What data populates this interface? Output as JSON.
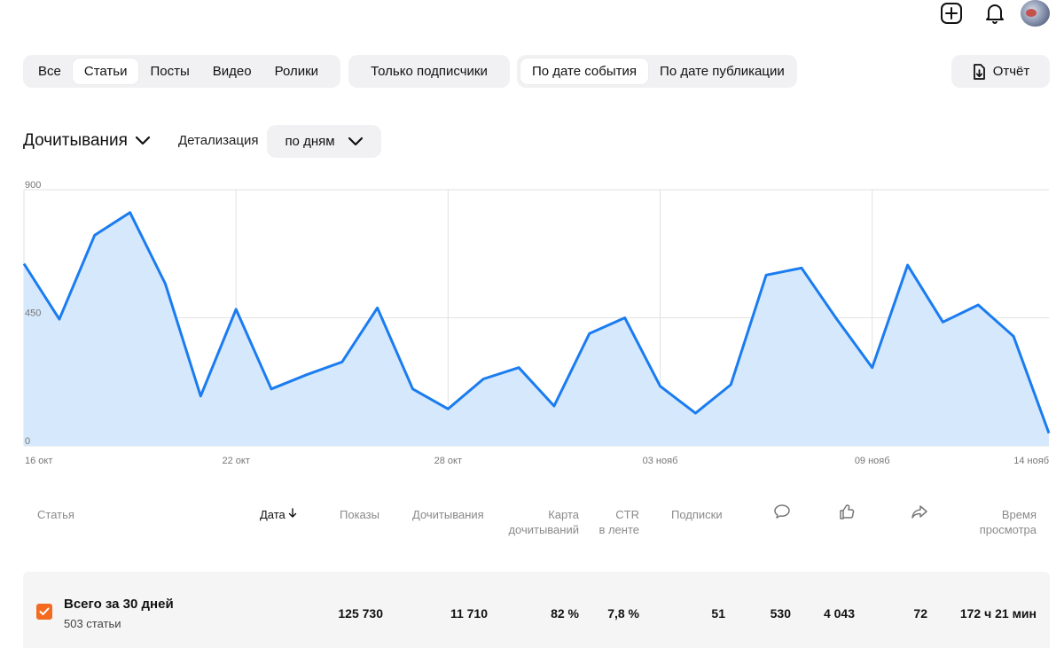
{
  "topbar": {
    "icons": [
      "add-icon",
      "bell-icon",
      "avatar"
    ]
  },
  "filters": {
    "content_types": [
      "Все",
      "Статьи",
      "Посты",
      "Видео",
      "Ролики"
    ],
    "active_content_type": "Статьи",
    "subscribers_only": "Только подписчики",
    "date_modes": [
      "По дате события",
      "По дате публикации"
    ],
    "active_date_mode": "По дате события"
  },
  "report_button": "Отчёт",
  "metric": {
    "selected": "Дочитывания",
    "detail_label": "Детализация",
    "detail_value": "по дням"
  },
  "chart_data": {
    "type": "area",
    "ylim": [
      0,
      900
    ],
    "yticks": [
      "900",
      "450",
      "0"
    ],
    "xticks": [
      "16 окт",
      "22 окт",
      "28 окт",
      "03 нояб",
      "09 нояб",
      "14 нояб"
    ],
    "xtick_index": [
      0,
      6,
      12,
      18,
      24,
      29
    ],
    "grid": true,
    "values": [
      640,
      445,
      740,
      820,
      570,
      175,
      480,
      200,
      250,
      295,
      485,
      200,
      130,
      235,
      275,
      140,
      395,
      450,
      210,
      115,
      215,
      600,
      625,
      445,
      275,
      635,
      435,
      495,
      385,
      45
    ],
    "line_color": "#1a7cf0",
    "fill_color": "#d6e8fc"
  },
  "table": {
    "headers": {
      "article": "Статья",
      "date": "Дата",
      "impressions": "Показы",
      "reads": "Дочитывания",
      "read_map_1": "Карта",
      "read_map_2": "дочитываний",
      "ctr_1": "CTR",
      "ctr_2": "в ленте",
      "subscriptions": "Подписки",
      "comments_icon": "comment-icon",
      "likes_icon": "like-icon",
      "shares_icon": "share-icon",
      "view_time_1": "Время",
      "view_time_2": "просмотра"
    },
    "totals": {
      "title": "Всего за 30 дней",
      "subtitle": "503 статьи",
      "impressions": "125 730",
      "reads": "11 710",
      "read_map": "82 %",
      "ctr": "7,8 %",
      "subscriptions": "51",
      "comments": "530",
      "likes": "4 043",
      "shares": "72",
      "view_time": "172 ч 21 мин"
    }
  },
  "colors": {
    "accent": "#f36b21",
    "chart_line": "#1a7cf0",
    "pill_bg": "#f1f1f3"
  }
}
